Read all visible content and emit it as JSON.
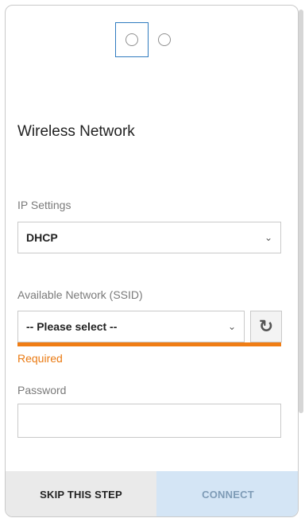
{
  "header": {
    "title": "Wireless Network"
  },
  "stepper": {
    "total_steps": 2,
    "current_step": 1
  },
  "ip_settings": {
    "label": "IP Settings",
    "selected": "DHCP",
    "chevron_icon": "chevron-down-icon"
  },
  "network": {
    "label": "Available Network (SSID)",
    "selected": "-- Please select --",
    "chevron_icon": "chevron-down-icon",
    "refresh_icon": "refresh-icon",
    "error_text": "Required",
    "error_color": "#f07d14"
  },
  "password": {
    "label": "Password",
    "value": ""
  },
  "footer": {
    "skip_label": "SKIP THIS STEP",
    "connect_label": "CONNECT",
    "connect_bg": "#d4e5f5"
  }
}
